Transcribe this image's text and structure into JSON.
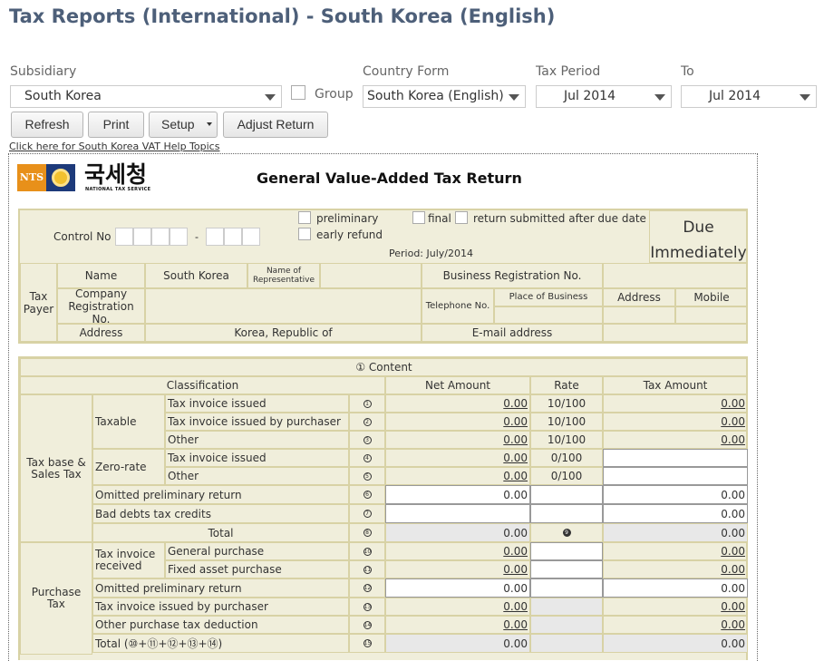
{
  "page": {
    "title": "Tax Reports (International) - South Korea (English)",
    "help_link": "Click here for South Korea VAT Help Topics"
  },
  "filters": {
    "subsidiary_label": "Subsidiary",
    "subsidiary_value": "South Korea",
    "group_label": "Group",
    "country_form_label": "Country Form",
    "country_form_value": "South Korea (English)",
    "tax_period_label": "Tax Period",
    "tax_period_value": "Jul 2014",
    "to_label": "To",
    "to_value": "Jul 2014"
  },
  "buttons": {
    "refresh": "Refresh",
    "print": "Print",
    "setup": "Setup",
    "adjust": "Adjust Return"
  },
  "form": {
    "logo_abbr": "NTS",
    "logo_korean": "국세청",
    "logo_sub": "NATIONAL TAX SERVICE",
    "title": "General Value-Added Tax Return",
    "control_no_label": "Control No",
    "control_sep": "-",
    "preliminary": "preliminary",
    "final": "final",
    "return_after_due": "return submitted after due date",
    "early_refund": "early refund",
    "period": "Period: July/2014",
    "due": "Due",
    "immediately": "Immediately",
    "tax_payer": "Tax Payer",
    "name_label": "Name",
    "name_value": "South Korea",
    "representative_label": "Name of Representative",
    "brn_label": "Business Registration No.",
    "company_reg_label": "Company Registration No.",
    "telephone_label": "Telephone No.",
    "place_of_business": "Place of Business",
    "address_col": "Address",
    "mobile_col": "Mobile",
    "address_label": "Address",
    "address_value": "Korea, Republic of",
    "email_label": "E-mail address"
  },
  "content": {
    "header": "① Content",
    "classification": "Classification",
    "net_amount": "Net Amount",
    "rate": "Rate",
    "tax_amount": "Tax Amount",
    "sales_section": "Tax base & Sales Tax",
    "taxable": "Taxable",
    "zero_rate": "Zero-rate",
    "rows": [
      {
        "label": "Tax invoice issued",
        "num": "1",
        "net": "0.00",
        "rate": "10/100",
        "tax": "0.00"
      },
      {
        "label": "Tax invoice issued by purchaser",
        "num": "2",
        "net": "0.00",
        "rate": "10/100",
        "tax": "0.00"
      },
      {
        "label": "Other",
        "num": "3",
        "net": "0.00",
        "rate": "10/100",
        "tax": "0.00"
      },
      {
        "label": "Tax invoice issued",
        "num": "4",
        "net": "0.00",
        "rate": "0/100",
        "tax": ""
      },
      {
        "label": "Other",
        "num": "5",
        "net": "0.00",
        "rate": "0/100",
        "tax": ""
      },
      {
        "label": "Omitted preliminary return",
        "num": "6",
        "net": "0.00",
        "rate": "",
        "tax": "0.00"
      },
      {
        "label": "Bad debts tax credits",
        "num": "7",
        "net": "",
        "rate": "",
        "tax": "0.00"
      },
      {
        "label": "Total",
        "num": "8",
        "net": "0.00",
        "rate": "9",
        "tax": "0.00"
      }
    ],
    "purchase_section": "Purchase Tax",
    "tax_invoice_received": "Tax invoice received",
    "prows": [
      {
        "label": "General purchase",
        "num": "10",
        "net": "0.00",
        "tax": "0.00"
      },
      {
        "label": "Fixed asset purchase",
        "num": "11",
        "net": "0.00",
        "tax": "0.00"
      },
      {
        "label": "Omitted preliminary return",
        "num": "12",
        "net": "0.00",
        "tax": "0.00"
      },
      {
        "label": "Tax invoice issued by purchaser",
        "num": "13",
        "net": "0.00",
        "tax": "0.00"
      },
      {
        "label": "Other purchase tax deduction",
        "num": "14",
        "net": "0.00",
        "tax": "0.00"
      },
      {
        "label": "Total (⑩+⑪+⑫+⑬+⑭)",
        "num": "15",
        "net": "0.00",
        "tax": "0.00"
      }
    ]
  }
}
